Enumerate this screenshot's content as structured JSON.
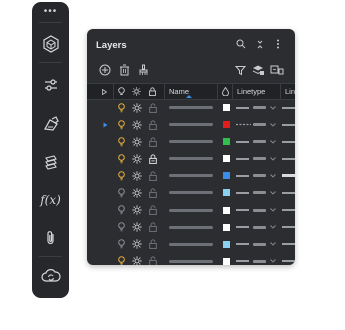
{
  "toolbar": {
    "more_glyph": "•••",
    "items": [
      {
        "name": "cube-icon"
      },
      {
        "name": "sliders-icon"
      },
      {
        "name": "edit-sheet-icon"
      },
      {
        "name": "layers-icon"
      },
      {
        "name": "function-icon",
        "label": "f(x)"
      },
      {
        "name": "paperclip-icon"
      },
      {
        "name": "cloud-sync-icon"
      }
    ]
  },
  "panel": {
    "title": "Layers",
    "header_icons": [
      "search-icon",
      "collapse-icon",
      "more-vertical-icon"
    ],
    "actions": [
      "new-layer-icon",
      "delete-icon",
      "brush-icon"
    ],
    "right_actions": [
      "filter-icon",
      "layer-states-icon",
      "layer-settings-icon"
    ],
    "columns": {
      "name": "Name",
      "linetype": "Linetype",
      "lineweight": "Lin"
    },
    "current_row": 1,
    "rows": [
      {
        "color": "#ffffff",
        "bulb": "#e8b23a",
        "locked": false,
        "linetype": "continuous"
      },
      {
        "color": "#e01e1e",
        "bulb": "#e8b23a",
        "locked": false,
        "linetype": "dashed"
      },
      {
        "color": "#2fbf4f",
        "bulb": "#e8b23a",
        "locked": false,
        "linetype": "continuous"
      },
      {
        "color": "#ffffff",
        "bulb": "#e8b23a",
        "locked": true,
        "linetype": "continuous"
      },
      {
        "color": "#3a8ee6",
        "bulb": "#e8b23a",
        "locked": false,
        "linetype": "continuous"
      },
      {
        "color": "#8ad0f0",
        "bulb": "#8c8f94",
        "locked": false,
        "linetype": "continuous"
      },
      {
        "color": "#ffffff",
        "bulb": "#8c8f94",
        "locked": false,
        "linetype": "continuous"
      },
      {
        "color": "#ffffff",
        "bulb": "#8c8f94",
        "locked": false,
        "linetype": "continuous"
      },
      {
        "color": "#8ad0f0",
        "bulb": "#8c8f94",
        "locked": false,
        "linetype": "continuous"
      },
      {
        "color": "#ffffff",
        "bulb": "#e8b23a",
        "locked": false,
        "linetype": "continuous"
      }
    ]
  },
  "colors": {
    "panel_bg": "#2b2d31",
    "header_bg": "#202226",
    "accent": "#3a8ee6",
    "bulb_on": "#e8b23a",
    "bulb_off": "#8c8f94"
  }
}
